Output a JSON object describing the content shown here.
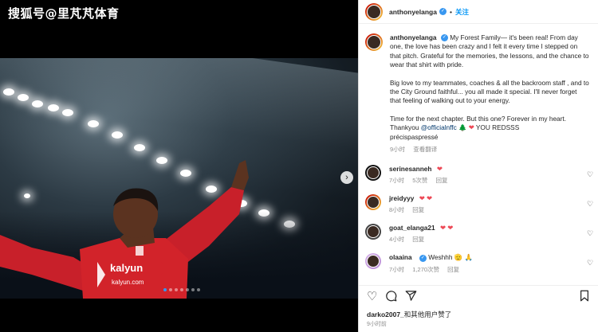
{
  "watermark": "搜狐号@里芃芃体育",
  "post": {
    "username": "anthonyelanga",
    "follow_label": "关注",
    "separator": "•",
    "verified_icon": "✓",
    "caption": {
      "username": "anthonyelanga",
      "p1": "My Forest Family— it's been real! From day one, the love has been crazy and I felt it every time I stepped on that pitch. Grateful for the memories, the lessons, and the chance to wear that shirt with pride.",
      "p2": "Big love to my teammates, coaches & all the backroom staff , and to the City Ground faithful... you all made it special. I'll never forget that feeling of walking out to your energy.",
      "p3_line1": "Time for the next chapter. But this one? Forever in my heart.",
      "p3_thanks": "Thankyou",
      "p3_mention": "@officialnffc",
      "p3_emojis": "🌲 ❤",
      "p3_tail": "YOU REDSSS",
      "p3_line3": "précispaspressé",
      "time": "9小时",
      "translate": "查看翻译"
    },
    "comments": [
      {
        "username": "serinesanneh",
        "text": "❤",
        "time": "7小时",
        "likes": "5次赞",
        "reply": "回复"
      },
      {
        "username": "jreidyyy",
        "text": "❤ ❤",
        "time": "8小时",
        "likes": "",
        "reply": "回复"
      },
      {
        "username": "goat_elanga21",
        "text": "❤ ❤",
        "time": "4小时",
        "likes": "",
        "reply": "回复"
      },
      {
        "username": "olaaina",
        "text": "Weshhh 🫡 🙏",
        "time": "7小时",
        "likes": "1,270次赞",
        "reply": "回复"
      }
    ],
    "likes_by": "darko2007_",
    "likes_text": "和其他用户赞了",
    "post_time": "9小时前"
  },
  "icons": {
    "next": "chevron-right-icon",
    "heart": "heart-icon",
    "comment": "comment-icon",
    "share": "share-icon",
    "bookmark": "bookmark-icon"
  },
  "colors": {
    "accent": "#0095f6",
    "verified": "#3897f0",
    "heart": "#ed4956",
    "jersey": "#d2232a"
  }
}
